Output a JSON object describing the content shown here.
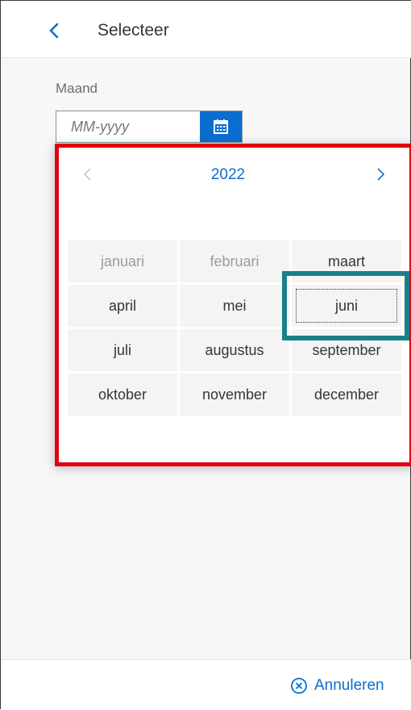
{
  "header": {
    "title": "Selecteer",
    "back_icon": "chevron-left-icon"
  },
  "field": {
    "label": "Maand",
    "value": "",
    "placeholder": "MM-yyyy",
    "button_icon": "calendar-icon"
  },
  "picker": {
    "year": "2022",
    "prev_icon": "chevron-left-icon",
    "next_icon": "chevron-right-icon",
    "months": [
      {
        "label": "januari",
        "disabled": true
      },
      {
        "label": "februari",
        "disabled": true
      },
      {
        "label": "maart",
        "disabled": false
      },
      {
        "label": "april",
        "disabled": false
      },
      {
        "label": "mei",
        "disabled": false
      },
      {
        "label": "juni",
        "disabled": false,
        "focused": true
      },
      {
        "label": "juli",
        "disabled": false
      },
      {
        "label": "augustus",
        "disabled": false
      },
      {
        "label": "september",
        "disabled": false
      },
      {
        "label": "oktober",
        "disabled": false
      },
      {
        "label": "november",
        "disabled": false
      },
      {
        "label": "december",
        "disabled": false
      }
    ]
  },
  "footer": {
    "cancel_label": "Annuleren",
    "cancel_icon": "cancel-circle-icon"
  },
  "colors": {
    "accent": "#0a6ed1",
    "highlight_red": "#e0000f",
    "highlight_teal": "#1b7f8a"
  }
}
